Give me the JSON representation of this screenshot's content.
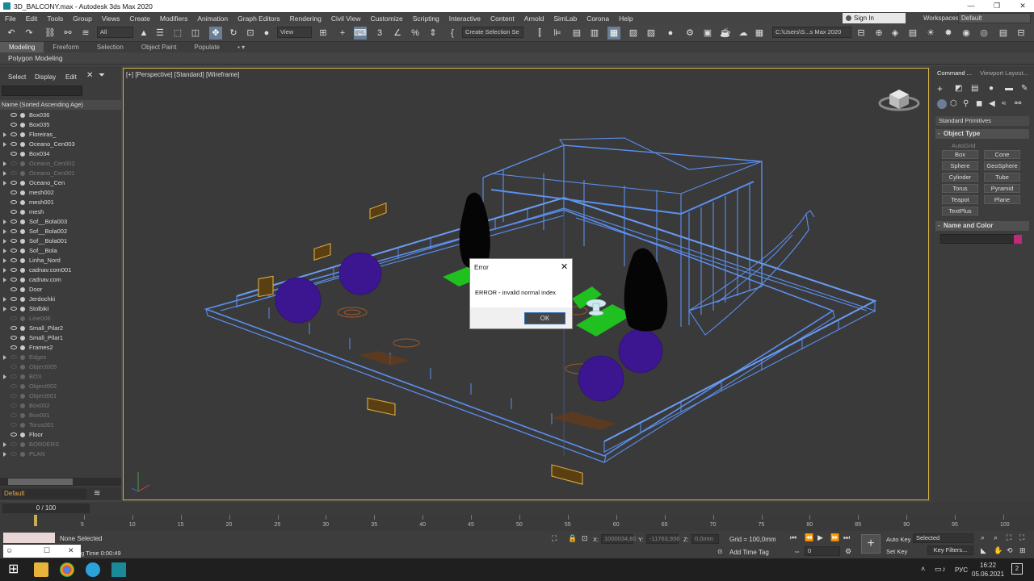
{
  "window": {
    "title": "3D_BALCONY.max - Autodesk 3ds Max 2020"
  },
  "menu": [
    "File",
    "Edit",
    "Tools",
    "Group",
    "Views",
    "Create",
    "Modifiers",
    "Animation",
    "Graph Editors",
    "Rendering",
    "Civil View",
    "Customize",
    "Scripting",
    "Interactive",
    "Content",
    "Arnold",
    "SimLab",
    "Corona",
    "Help"
  ],
  "account": {
    "signin": "Sign In",
    "workspaces_label": "Workspaces:",
    "workspace": "Default"
  },
  "toolbar": {
    "filter": "All",
    "ref_coord": "View",
    "selection_set": "Create Selection Se",
    "path": "C:\\Users\\S...s Max 2020"
  },
  "ribbon": {
    "tabs": [
      "Modeling",
      "Freeform",
      "Selection",
      "Object Paint",
      "Populate"
    ],
    "subtitle": "Polygon Modeling"
  },
  "explorer": {
    "menu": [
      "Select",
      "Display",
      "Edit"
    ],
    "column": "Name (Sorted Ascending Age)",
    "items": [
      {
        "name": "Box036",
        "dim": false,
        "exp": false
      },
      {
        "name": "Box035",
        "dim": false,
        "exp": false
      },
      {
        "name": "Floreiras_",
        "dim": false,
        "exp": true
      },
      {
        "name": "Oceano_Cen003",
        "dim": false,
        "exp": true
      },
      {
        "name": "Box034",
        "dim": false,
        "exp": false
      },
      {
        "name": "Oceano_Cen002",
        "dim": true,
        "exp": true
      },
      {
        "name": "Oceano_Cen001",
        "dim": true,
        "exp": true
      },
      {
        "name": "Oceano_Cen",
        "dim": false,
        "exp": true
      },
      {
        "name": "mesh002",
        "dim": false,
        "exp": false
      },
      {
        "name": "mesh001",
        "dim": false,
        "exp": false
      },
      {
        "name": "mesh",
        "dim": false,
        "exp": false
      },
      {
        "name": "Sof__Bola003",
        "dim": false,
        "exp": true
      },
      {
        "name": "Sof__Bola002",
        "dim": false,
        "exp": true
      },
      {
        "name": "Sof__Bola001",
        "dim": false,
        "exp": true
      },
      {
        "name": "Sof__Bola",
        "dim": false,
        "exp": true
      },
      {
        "name": "Linha_Nord",
        "dim": false,
        "exp": true
      },
      {
        "name": "cadnav.com001",
        "dim": false,
        "exp": true
      },
      {
        "name": "cadnav.com",
        "dim": false,
        "exp": true
      },
      {
        "name": "Door",
        "dim": false,
        "exp": false
      },
      {
        "name": "Jerdochki",
        "dim": false,
        "exp": true
      },
      {
        "name": "Stolbiki",
        "dim": false,
        "exp": true
      },
      {
        "name": "Line006",
        "dim": true,
        "exp": false
      },
      {
        "name": "Small_Pilar2",
        "dim": false,
        "exp": false
      },
      {
        "name": "Small_Pilar1",
        "dim": false,
        "exp": false
      },
      {
        "name": "Frames2",
        "dim": false,
        "exp": false
      },
      {
        "name": "Edges",
        "dim": true,
        "exp": true
      },
      {
        "name": "Object005",
        "dim": true,
        "exp": false
      },
      {
        "name": "BOX",
        "dim": true,
        "exp": true
      },
      {
        "name": "Object002",
        "dim": true,
        "exp": false
      },
      {
        "name": "Object001",
        "dim": true,
        "exp": false
      },
      {
        "name": "Box002",
        "dim": true,
        "exp": false
      },
      {
        "name": "Box001",
        "dim": true,
        "exp": false
      },
      {
        "name": "Torus001",
        "dim": true,
        "exp": false
      },
      {
        "name": "Floor",
        "dim": false,
        "exp": false
      },
      {
        "name": "BORDERS",
        "dim": true,
        "exp": true
      },
      {
        "name": "PLAN",
        "dim": true,
        "exp": true
      }
    ],
    "layer": "Default"
  },
  "viewport": {
    "label": "[+] [Perspective] [Standard] [Wireframe]"
  },
  "dialog": {
    "title": "Error",
    "message": "ERROR - invalid normal index",
    "ok": "OK"
  },
  "command_panel": {
    "tabs": [
      "Command ...",
      "Viewport Layout..."
    ],
    "category": "Standard Primitives",
    "object_type_title": "Object Type",
    "autogrid": "AutoGrid",
    "buttons": [
      "Box",
      "Cone",
      "Sphere",
      "GeoSphere",
      "Cylinder",
      "Tube",
      "Torus",
      "Pyramid",
      "Teapot",
      "Plane",
      "TextPlus"
    ],
    "name_color_title": "Name and Color"
  },
  "timeline": {
    "frame": "0 / 100",
    "ticks": [
      "5",
      "10",
      "15",
      "20",
      "25",
      "30",
      "35",
      "40",
      "45",
      "50",
      "55",
      "60",
      "65",
      "70",
      "75",
      "80",
      "85",
      "90",
      "95",
      "100"
    ]
  },
  "status": {
    "selection": "None Selected",
    "time": "g Time 0:00:49",
    "x_label": "X:",
    "x": "1000034,80",
    "y_label": "Y:",
    "y": "-11763,936",
    "z_label": "Z:",
    "z": "0,0mm",
    "grid": "Grid = 100,0mm",
    "add_time_tag": "Add Time Tag",
    "auto_key": "Auto Key",
    "selected": "Selected",
    "set_key": "Set Key",
    "key_filters": "Key Filters...",
    "frame": "0"
  },
  "taskbar": {
    "lang": "РУС",
    "clock": "16:22",
    "date": "05.06.2021",
    "notifications": "2"
  },
  "colors": {
    "accent": "#6a7f95",
    "wire": "#5a8ff0",
    "sphere": "#3c1590",
    "grass": "#1fc01f",
    "gold": "#e5b445",
    "viewport_border": "#d6b24a"
  }
}
